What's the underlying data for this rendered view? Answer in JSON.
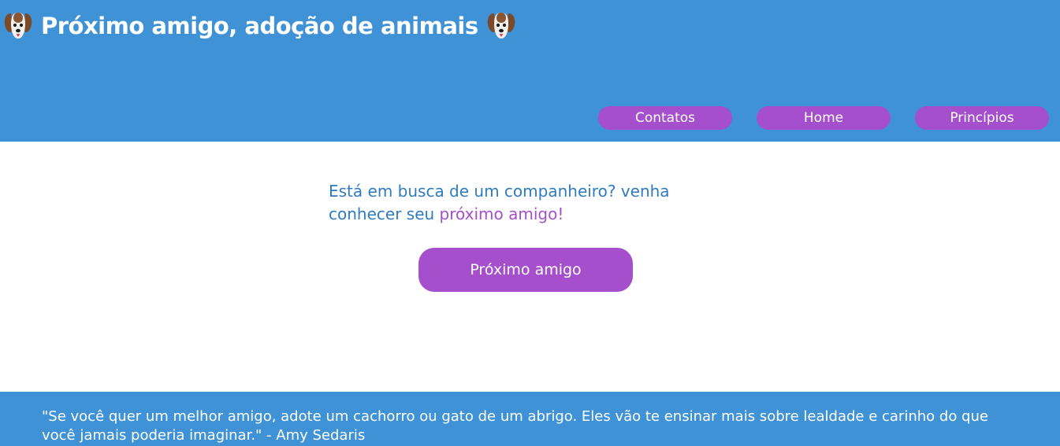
{
  "header": {
    "title": "Próximo amigo, adoção de animais",
    "left_icon": "dog-face-icon",
    "right_icon": "dog-face-icon",
    "nav": [
      {
        "label": "Contatos"
      },
      {
        "label": "Home"
      },
      {
        "label": "Princípios"
      }
    ]
  },
  "main": {
    "tagline_start": "Está em busca de um companheiro? venha conhecer seu ",
    "tagline_highlight": "próximo amigo!",
    "cta_label": "Próximo amigo"
  },
  "footer": {
    "quote": "\"Se você quer um melhor amigo, adote um cachorro ou gato de um abrigo. Eles vão te ensinar mais sobre lealdade e carinho do que você jamais poderia imaginar.\" - Amy Sedaris"
  },
  "colors": {
    "header_bg": "#3f92d5",
    "accent_purple": "#a54fcd",
    "text_blue": "#2f7bbf",
    "white": "#ffffff"
  }
}
